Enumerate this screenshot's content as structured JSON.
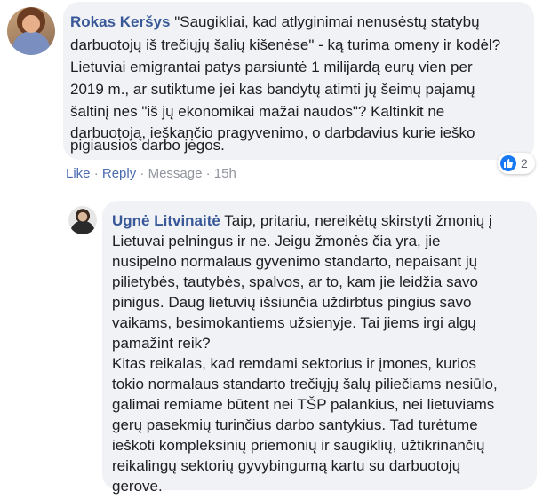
{
  "comment": {
    "author": "Rokas Keršys",
    "text_lines": [
      " \"Saugikliai, kad atlyginimai nenusėstų statybų",
      "darbuotojų iš trečiųjų šalių kišenėse\" - ką turima omeny ir kodėl?",
      "Lietuviai emigrantai patys parsiuntė 1 milijardą eurų vien per",
      "2019 m., ar sutiktume jei kas bandytų atimti jų šeimų pajamų",
      "šaltinį nes \"iš jų ekonomikai mažai naudos\"? Kaltinkit ne",
      "darbuotoją, ieškančio pragyvenimo, o darbdavius kurie ieško",
      "pigiausios darbo jėgos."
    ],
    "actions": {
      "like": "Like",
      "reply": "Reply",
      "message": "Message",
      "time": "15h",
      "separator": " · "
    },
    "reaction_count": "2",
    "reaction_icon": "like-icon",
    "accent_color": "#385898",
    "reaction_color": "#1877f2"
  },
  "reply": {
    "author": "Ugnė Litvinaitė",
    "text_lines": [
      " Taip, pritariu, nereikėtų skirstyti žmonių į",
      "Lietuvai pelningus ir ne. Jeigu žmonės čia yra, jie",
      "nusipelno normalaus gyvenimo standarto, nepaisant jų",
      "pilietybės, tautybės, spalvos, ar to, kam jie leidžia savo",
      "pinigus. Daug lietuvių išsiunčia uždirbtus pingius savo",
      "vaikams, besimokantiems užsienyje. Tai jiems irgi algų",
      "pamažint reik?",
      "Kitas reikalas, kad remdami sektorius ir įmones, kurios",
      "tokio normalaus standarto trečiųjų šalų piliečiams nesiūlo,",
      "galimai remiame būtent nei TŠP palankius, nei lietuviams",
      "gerų pasekmių turinčius darbo santykius. Tad turėtume",
      "ieškoti kompleksinių priemonių ir saugiklių, užtikrinančių",
      "reikalingų sektorių gyvybingumą kartu su darbuotojų",
      "gerove."
    ]
  }
}
